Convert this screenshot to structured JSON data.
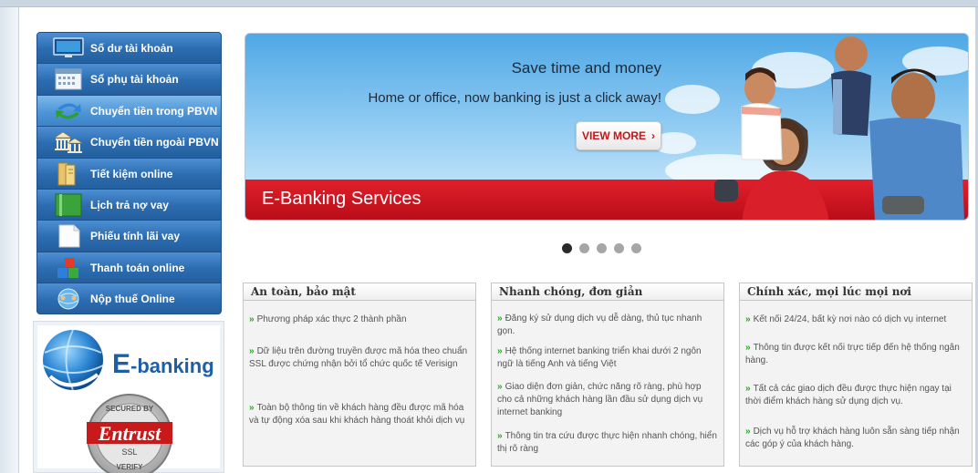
{
  "menu": {
    "items": [
      {
        "label": "Số dư tài khoản",
        "icon": "monitor-icon"
      },
      {
        "label": "Sổ phụ tài khoản",
        "icon": "calendar-icon"
      },
      {
        "label": "Chuyển tiền trong PBVN",
        "icon": "transfer-arrows-icon",
        "active": true
      },
      {
        "label": "Chuyển tiền ngoài PBVN",
        "icon": "bank-buildings-icon"
      },
      {
        "label": "Tiết kiệm online",
        "icon": "document-icon"
      },
      {
        "label": "Lịch trả nợ vay",
        "icon": "ledger-icon"
      },
      {
        "label": "Phiếu tính lãi vay",
        "icon": "page-icon"
      },
      {
        "label": "Thanh toán online",
        "icon": "cubes-icon"
      },
      {
        "label": "Nộp thuế Online",
        "icon": "globe-people-icon"
      }
    ]
  },
  "logo_panel": {
    "ebanking_text": "E-banking",
    "entrust_text": "Entrust",
    "secured_by_text": "SECURED BY",
    "ssl_text": "SSL",
    "verify_text": "VERIFY"
  },
  "banner": {
    "headline": "Save time and money",
    "subheadline": "Home or office, now banking is just a click away!",
    "cta_label": "VIEW MORE",
    "cta_chevron": "›",
    "title": "E-Banking Services"
  },
  "carousel": {
    "dots": 5,
    "active_index": 0
  },
  "features": [
    {
      "heading": "An toàn, bảo mật",
      "items": [
        "Phương pháp xác thực 2 thành phần",
        "Dữ liệu trên đường truyền được mã hóa theo chuẩn SSL được chứng nhận bởi tổ chức quốc tế Verisign",
        "Toàn bộ thông tin về khách hàng đều được mã hóa và tự động xóa sau khi khách hàng thoát khỏi dịch vụ"
      ]
    },
    {
      "heading": "Nhanh chóng, đơn giản",
      "items": [
        "Đăng ký sử dụng dịch vụ dễ dàng, thủ tục nhanh gọn.",
        "Hệ thống internet banking triển khai dưới 2 ngôn ngữ là tiếng Anh và tiếng Việt",
        "Giao diện đơn giản, chức năng rõ ràng, phù hợp cho cả những khách hàng lần đầu sử dụng dịch vụ internet banking",
        "Thông tin tra cứu được thực hiện nhanh chóng, hiển thị rõ ràng"
      ]
    },
    {
      "heading": "Chính xác, mọi lúc mọi nơi",
      "items": [
        "Kết nối 24/24, bất kỳ nơi nào có dịch vụ internet",
        "Thông tin được kết nối trực tiếp đến hệ thống ngân hàng.",
        "Tất cả các giao dịch đều được thực hiện ngay tại thời điểm khách hàng sử dụng dịch vụ.",
        "Dịch vụ hỗ trợ khách hàng luôn sẵn sàng tiếp nhận các góp ý của khách hàng."
      ]
    }
  ],
  "bullet_glyph": "»",
  "colors": {
    "menu_blue": "#2e6eaf",
    "banner_red": "#d11a24",
    "bullet_green": "#2aa12a",
    "cta_red": "#c4151c"
  }
}
